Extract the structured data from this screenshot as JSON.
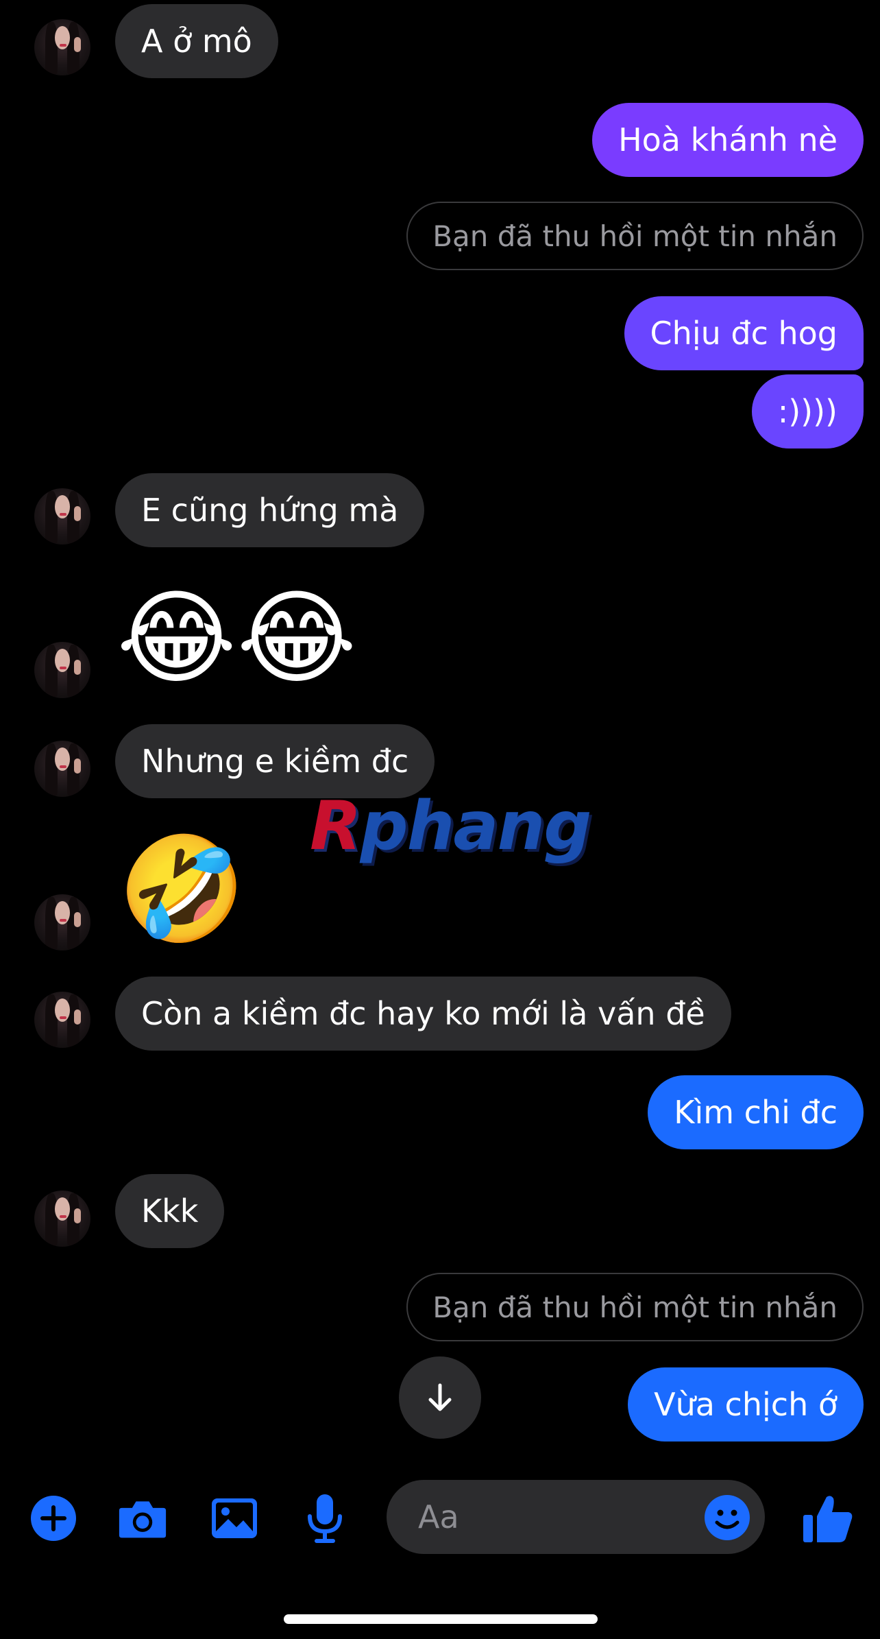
{
  "messages": [
    {
      "id": "m1",
      "sender": "them",
      "type": "text",
      "text": "A ở mô"
    },
    {
      "id": "m2",
      "sender": "me",
      "type": "text",
      "text": "Hoà khánh nè"
    },
    {
      "id": "m3",
      "sender": "me",
      "type": "retracted",
      "text": "Bạn đã thu hồi một tin nhắn"
    },
    {
      "id": "m4",
      "sender": "me",
      "type": "text",
      "text": "Chịu đc hog"
    },
    {
      "id": "m5",
      "sender": "me",
      "type": "text",
      "text": ":))))"
    },
    {
      "id": "m6",
      "sender": "them",
      "type": "text",
      "text": "E cũng hứng mà"
    },
    {
      "id": "m7",
      "sender": "them",
      "type": "emoji",
      "text": "😂😂"
    },
    {
      "id": "m8",
      "sender": "them",
      "type": "text",
      "text": "Nhưng e kiềm đc"
    },
    {
      "id": "m9",
      "sender": "them",
      "type": "emoji",
      "text": "🤣"
    },
    {
      "id": "m10",
      "sender": "them",
      "type": "text",
      "text": "Còn a kiềm đc hay ko mới là vấn đề"
    },
    {
      "id": "m11",
      "sender": "me",
      "type": "text",
      "text": "Kìm chi đc"
    },
    {
      "id": "m12",
      "sender": "them",
      "type": "text",
      "text": "Kkk"
    },
    {
      "id": "m13",
      "sender": "me",
      "type": "retracted",
      "text": "Bạn đã thu hồi một tin nhắn"
    },
    {
      "id": "m14",
      "sender": "me",
      "type": "text",
      "text": "Vừa chịch ớ"
    }
  ],
  "watermark": {
    "part1": "R",
    "part2": "phang"
  },
  "composer": {
    "placeholder": "Aa",
    "icons": [
      "plus-icon",
      "camera-icon",
      "image-icon",
      "microphone-icon",
      "emoji-icon",
      "thumbs-up-icon"
    ]
  },
  "colors": {
    "background": "#000000",
    "incoming_bubble": "#2c2c2e",
    "outgoing_purple": "#7a3cff",
    "outgoing_blue": "#1b6bff",
    "accent": "#1b6bff"
  }
}
